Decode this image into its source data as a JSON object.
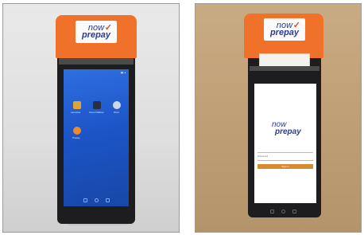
{
  "photos": [
    {
      "printer_label": {
        "brand_top": "now",
        "brand_bottom": "prepay",
        "accent_mark": "✓"
      },
      "screen": {
        "apps": [
          {
            "label": "Launcher",
            "icon": "folder-icon",
            "color": "#e0a33a"
          },
          {
            "label": "Sunmi Market",
            "icon": "store-icon",
            "color": "#2a2f44"
          },
          {
            "label": "Wi-Fi",
            "icon": "settings-icon",
            "color": "#cfd8ea"
          },
          {
            "label": "Prepay",
            "icon": "prepay-icon",
            "color": "#e98b2a"
          }
        ]
      }
    },
    {
      "printer_label": {
        "brand_top": "now",
        "brand_bottom": "prepay",
        "accent_mark": "✓"
      },
      "screen": {
        "logo_top": "now",
        "logo_bottom": "prepay",
        "field_label": "Password",
        "button_label": "Sign in",
        "button_color": "#d88a2e"
      }
    }
  ],
  "colors": {
    "printer_orange": "#f0722a",
    "screen_blue": "#1c55c8",
    "device_black": "#1d1d1f"
  }
}
